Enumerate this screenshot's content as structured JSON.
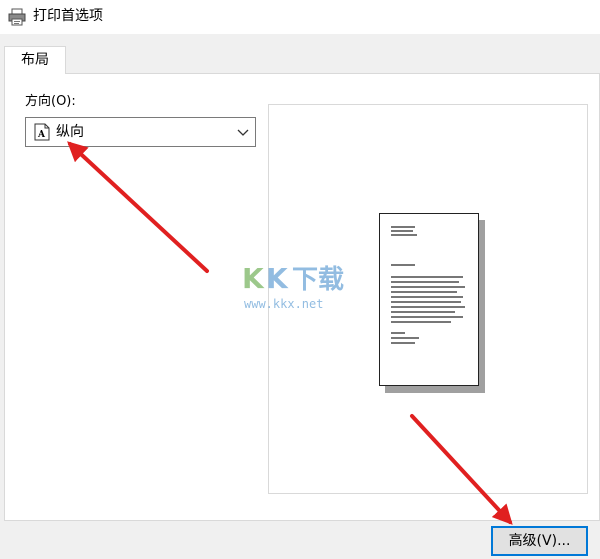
{
  "window": {
    "title": "打印首选项"
  },
  "tabs": [
    {
      "label": "布局",
      "active": true
    }
  ],
  "orientation": {
    "label": "方向(O):",
    "selected": "纵向",
    "icon": "portrait-document-icon"
  },
  "buttons": {
    "advanced_label": "高级(V)..."
  },
  "watermark": {
    "brand": "KK下载",
    "url": "www.kkx.net"
  },
  "colors": {
    "arrow": "#e02020",
    "focus_border": "#0078d7",
    "dialog_bg": "#f0f0f0"
  }
}
